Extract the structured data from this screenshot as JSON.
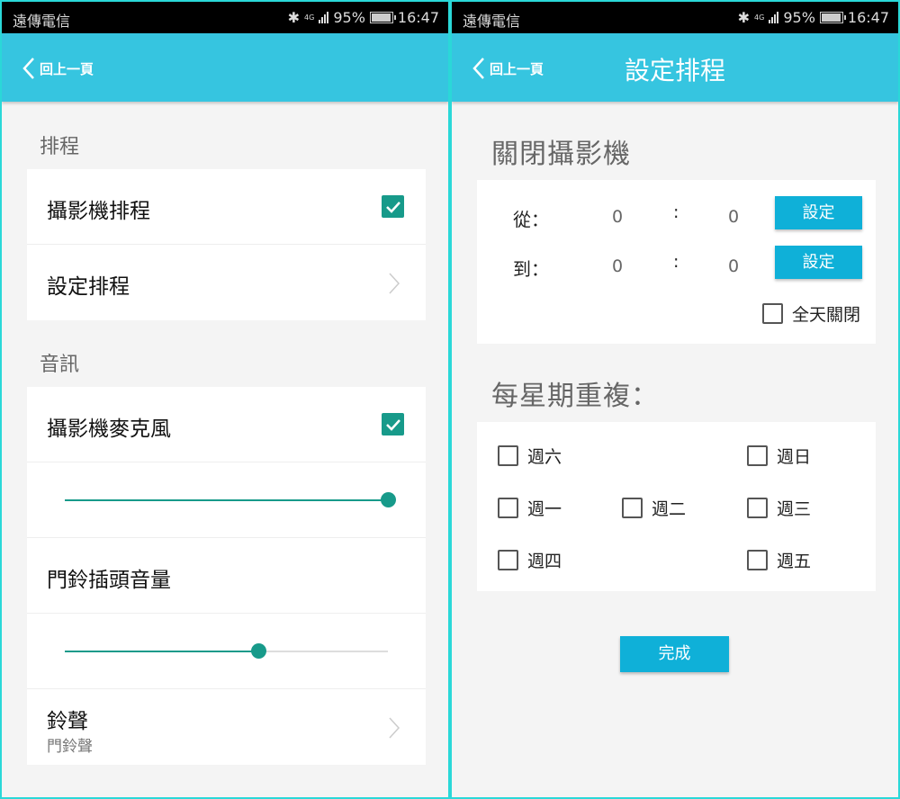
{
  "status": {
    "carrier": "遠傳電信",
    "network": "4G",
    "battery": "95%",
    "time": "16:47"
  },
  "left": {
    "back_label": "回上一頁",
    "sections": [
      {
        "title": "排程",
        "items": [
          {
            "label": "攝影機排程",
            "checked": true
          },
          {
            "label": "設定排程"
          }
        ]
      },
      {
        "title": "音訊",
        "items": [
          {
            "label": "攝影機麥克風",
            "checked": true
          },
          {
            "slider_value": 1.0
          },
          {
            "label": "門鈴插頭音量"
          },
          {
            "slider_value": 0.6
          },
          {
            "label": "鈴聲",
            "sublabel": "門鈴聲"
          }
        ]
      }
    ]
  },
  "right": {
    "back_label": "回上一頁",
    "title": "設定排程",
    "off_section": {
      "title": "關閉攝影機",
      "from_label": "從：",
      "to_label": "到：",
      "from_hour": "0",
      "from_min": "0",
      "to_hour": "0",
      "to_min": "0",
      "separator": ":",
      "set_label": "設定",
      "all_day_label": "全天關閉",
      "all_day_checked": false
    },
    "repeat": {
      "title": "每星期重複：",
      "days": [
        "週六",
        "週日",
        "週一",
        "週二",
        "週三",
        "週四",
        "週五"
      ]
    },
    "done_label": "完成"
  },
  "colors": {
    "accent": "#36c5e0",
    "button": "#0fb0d8",
    "check": "#179a8a"
  }
}
